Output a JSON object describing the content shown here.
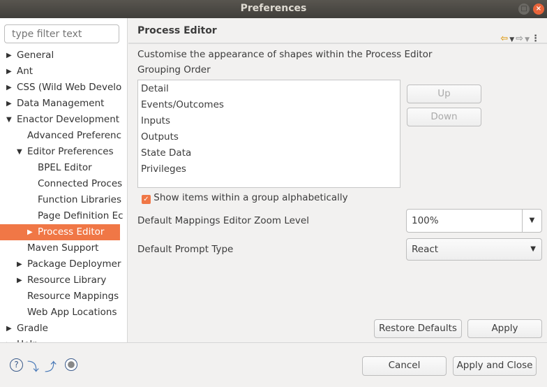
{
  "window": {
    "title": "Preferences"
  },
  "filter": {
    "placeholder": "type filter text"
  },
  "tree": [
    {
      "label": "General",
      "level": 0,
      "arrow": "right"
    },
    {
      "label": "Ant",
      "level": 0,
      "arrow": "right"
    },
    {
      "label": "CSS (Wild Web Develo",
      "level": 0,
      "arrow": "right"
    },
    {
      "label": "Data Management",
      "level": 0,
      "arrow": "right"
    },
    {
      "label": "Enactor Development",
      "level": 0,
      "arrow": "down"
    },
    {
      "label": "Advanced Preferenc",
      "level": 1,
      "arrow": ""
    },
    {
      "label": "Editor Preferences",
      "level": 1,
      "arrow": "down"
    },
    {
      "label": "BPEL Editor",
      "level": 2,
      "arrow": ""
    },
    {
      "label": "Connected Proces",
      "level": 2,
      "arrow": ""
    },
    {
      "label": "Function Libraries",
      "level": 2,
      "arrow": ""
    },
    {
      "label": "Page Definition Ec",
      "level": 2,
      "arrow": ""
    },
    {
      "label": "Process Editor",
      "level": 2,
      "arrow": "right",
      "selected": true
    },
    {
      "label": "Maven Support",
      "level": 1,
      "arrow": ""
    },
    {
      "label": "Package Deploymer",
      "level": 1,
      "arrow": "right"
    },
    {
      "label": "Resource Library",
      "level": 1,
      "arrow": "right"
    },
    {
      "label": "Resource Mappings",
      "level": 1,
      "arrow": ""
    },
    {
      "label": "Web App Locations",
      "level": 1,
      "arrow": ""
    },
    {
      "label": "Gradle",
      "level": 0,
      "arrow": "right"
    },
    {
      "label": "Help",
      "level": 0,
      "arrow": "right"
    }
  ],
  "page": {
    "title": "Process Editor",
    "description": "Customise the appearance of shapes within the Process Editor",
    "grouping_label": "Grouping Order",
    "grouping_items": [
      "Detail",
      "Events/Outcomes",
      "Inputs",
      "Outputs",
      "State Data",
      "Privileges"
    ],
    "up": "Up",
    "down": "Down",
    "alpha_checkbox": {
      "label": "Show items within a group alphabetically",
      "checked": true
    },
    "zoom_label": "Default Mappings Editor Zoom Level",
    "zoom_value": "100%",
    "prompt_label": "Default Prompt Type",
    "prompt_value": "React",
    "restore": "Restore Defaults",
    "apply": "Apply"
  },
  "footer": {
    "cancel": "Cancel",
    "apply_close": "Apply and Close"
  },
  "colors": {
    "accent": "#f07746"
  }
}
